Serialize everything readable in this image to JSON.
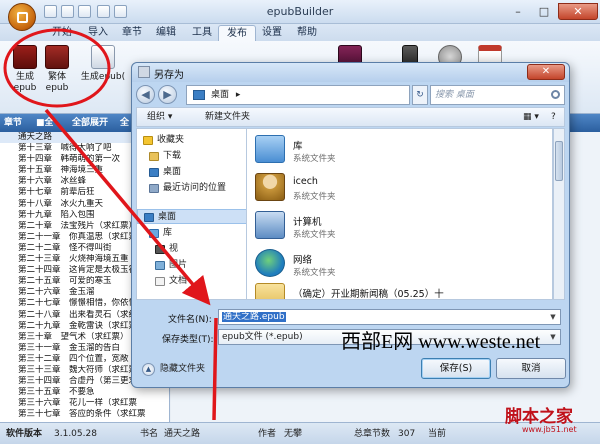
{
  "app": {
    "title": "epubBuilder",
    "window_controls": {
      "minimize": "–",
      "maximize": "□",
      "close": "✕"
    },
    "ribbon_tabs": [
      "开始",
      "导入",
      "章节",
      "编辑",
      "工具",
      "发布",
      "设置",
      "帮助"
    ],
    "active_tab": "发布",
    "ribbon_buttons": [
      {
        "line1": "生成",
        "line2": "epub",
        "icon": "epub-book-icon"
      },
      {
        "line1": "繁体",
        "line2": "epub",
        "icon": "traditional-book-icon"
      },
      {
        "line1": "生成epub(",
        "line2": "",
        "icon": "document-icon"
      }
    ]
  },
  "chapter_toolbar": {
    "title": "章节",
    "select_all": "全选",
    "expand_all": "全部展开",
    "cut": "全"
  },
  "chapters": [
    "通天之路",
    "第十三章　喊得太响了吧",
    "第十四章　韩萌萌的第一次",
    "第十五章　神海境三重",
    "第十六章　冰丝蜂",
    "第十七章　前辈后狂",
    "第十八章　冰火九重天",
    "第十九章　陷入包围",
    "第二十章　法宝残片（求红票）",
    "第二十一章　你真温思（求红票",
    "第二十二章　怪不得叫街",
    "第二十三章　火烧神海境五重",
    "第二十四章　这肯定是太极玉符",
    "第二十五章　可爱的寒玉",
    "第二十六章　金玉溜",
    "第二十七章　憬憬相惜，你依惜",
    "第二十八章　出来看灵石（求红",
    "第二十九章　金乾雷诀（求红票",
    "第三十章　望气术（求红票）",
    "第三十一章　金玉溜的告白",
    "第三十二章　四个位置，宽敞（求",
    "第三十三章　魏大符师（求红票",
    "第三十四章　合虚丹（第三更求",
    "第三十五章　不要急",
    "第三十六章　花儿一样（求红票",
    "第三十七章　答应的条件（求红票"
  ],
  "statusbar": {
    "version_label": "软件版本",
    "version": "3.1.05.28",
    "book_label": "书名",
    "book_name": "通天之路",
    "author_label": "作者",
    "author_name": "无攀",
    "total_label": "总章节数",
    "total": "307",
    "current_label": "当前"
  },
  "dialog": {
    "title": "另存为",
    "close_glyph": "✕",
    "address": "桌面",
    "address_arrow": "▸",
    "refresh_glyph": "↻",
    "search_placeholder": "搜索 桌面",
    "organize": "组织 ▾",
    "new_folder": "新建文件夹",
    "nav_items": [
      {
        "label": "收藏夹",
        "icon": "favorites-star-icon"
      },
      {
        "label": "下载",
        "icon": "download-folder-icon"
      },
      {
        "label": "桌面",
        "icon": "desktop-icon"
      },
      {
        "label": "最近访问的位置",
        "icon": "recent-places-icon"
      },
      {
        "label": "桌面",
        "icon": "desktop-icon"
      },
      {
        "label": "库",
        "icon": "library-icon"
      },
      {
        "label": "视",
        "icon": "video-icon"
      },
      {
        "label": "图片",
        "icon": "picture-icon"
      },
      {
        "label": "文档",
        "icon": "document-icon"
      }
    ],
    "files": [
      {
        "name": "库",
        "desc": "系统文件夹",
        "icon": "library-icon"
      },
      {
        "name": "icech",
        "desc": "系统文件夹",
        "icon": "user-folder-icon"
      },
      {
        "name": "计算机",
        "desc": "系统文件夹",
        "icon": "computer-icon"
      },
      {
        "name": "网络",
        "desc": "系统文件夹",
        "icon": "network-icon"
      },
      {
        "name": "（确定）开业期新闻稿（05.25）十",
        "desc": "",
        "icon": "folder-icon"
      }
    ],
    "filename_label": "文件名(N):",
    "filename_value": "通天之路.epub",
    "filetype_label": "保存类型(T):",
    "filetype_value": "epub文件 (*.epub)",
    "hide_folders": "隐藏文件夹",
    "save": "保存(S)",
    "cancel": "取消"
  },
  "watermark": "西部E网 www.weste.net",
  "corner_logo": "脚本之家",
  "corner_url": "www.jb51.net",
  "colors": {
    "annotation_red": "#e0161b",
    "ribbon_accent": "#2b5f9f",
    "selection": "#3170c7"
  }
}
